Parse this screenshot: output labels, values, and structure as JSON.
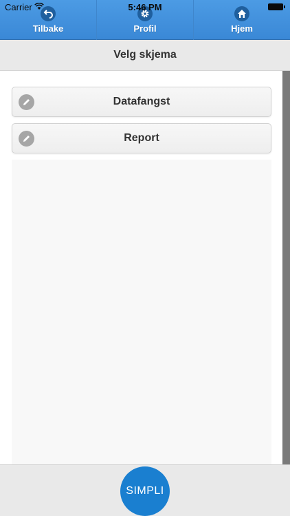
{
  "status": {
    "carrier": "Carrier",
    "time": "5:46 PM"
  },
  "nav": {
    "back": {
      "label": "Tilbake",
      "icon": "undo-icon"
    },
    "profile": {
      "label": "Profil",
      "icon": "gear-icon"
    },
    "home": {
      "label": "Hjem",
      "icon": "home-icon"
    }
  },
  "header": {
    "title": "Velg skjema"
  },
  "forms": [
    {
      "label": "Datafangst",
      "icon": "pencil-icon"
    },
    {
      "label": "Report",
      "icon": "pencil-icon"
    }
  ],
  "footer": {
    "logo_text": "SIMPLI"
  },
  "colors": {
    "accent": "#3a88d6",
    "logo": "#1a7fd0"
  }
}
